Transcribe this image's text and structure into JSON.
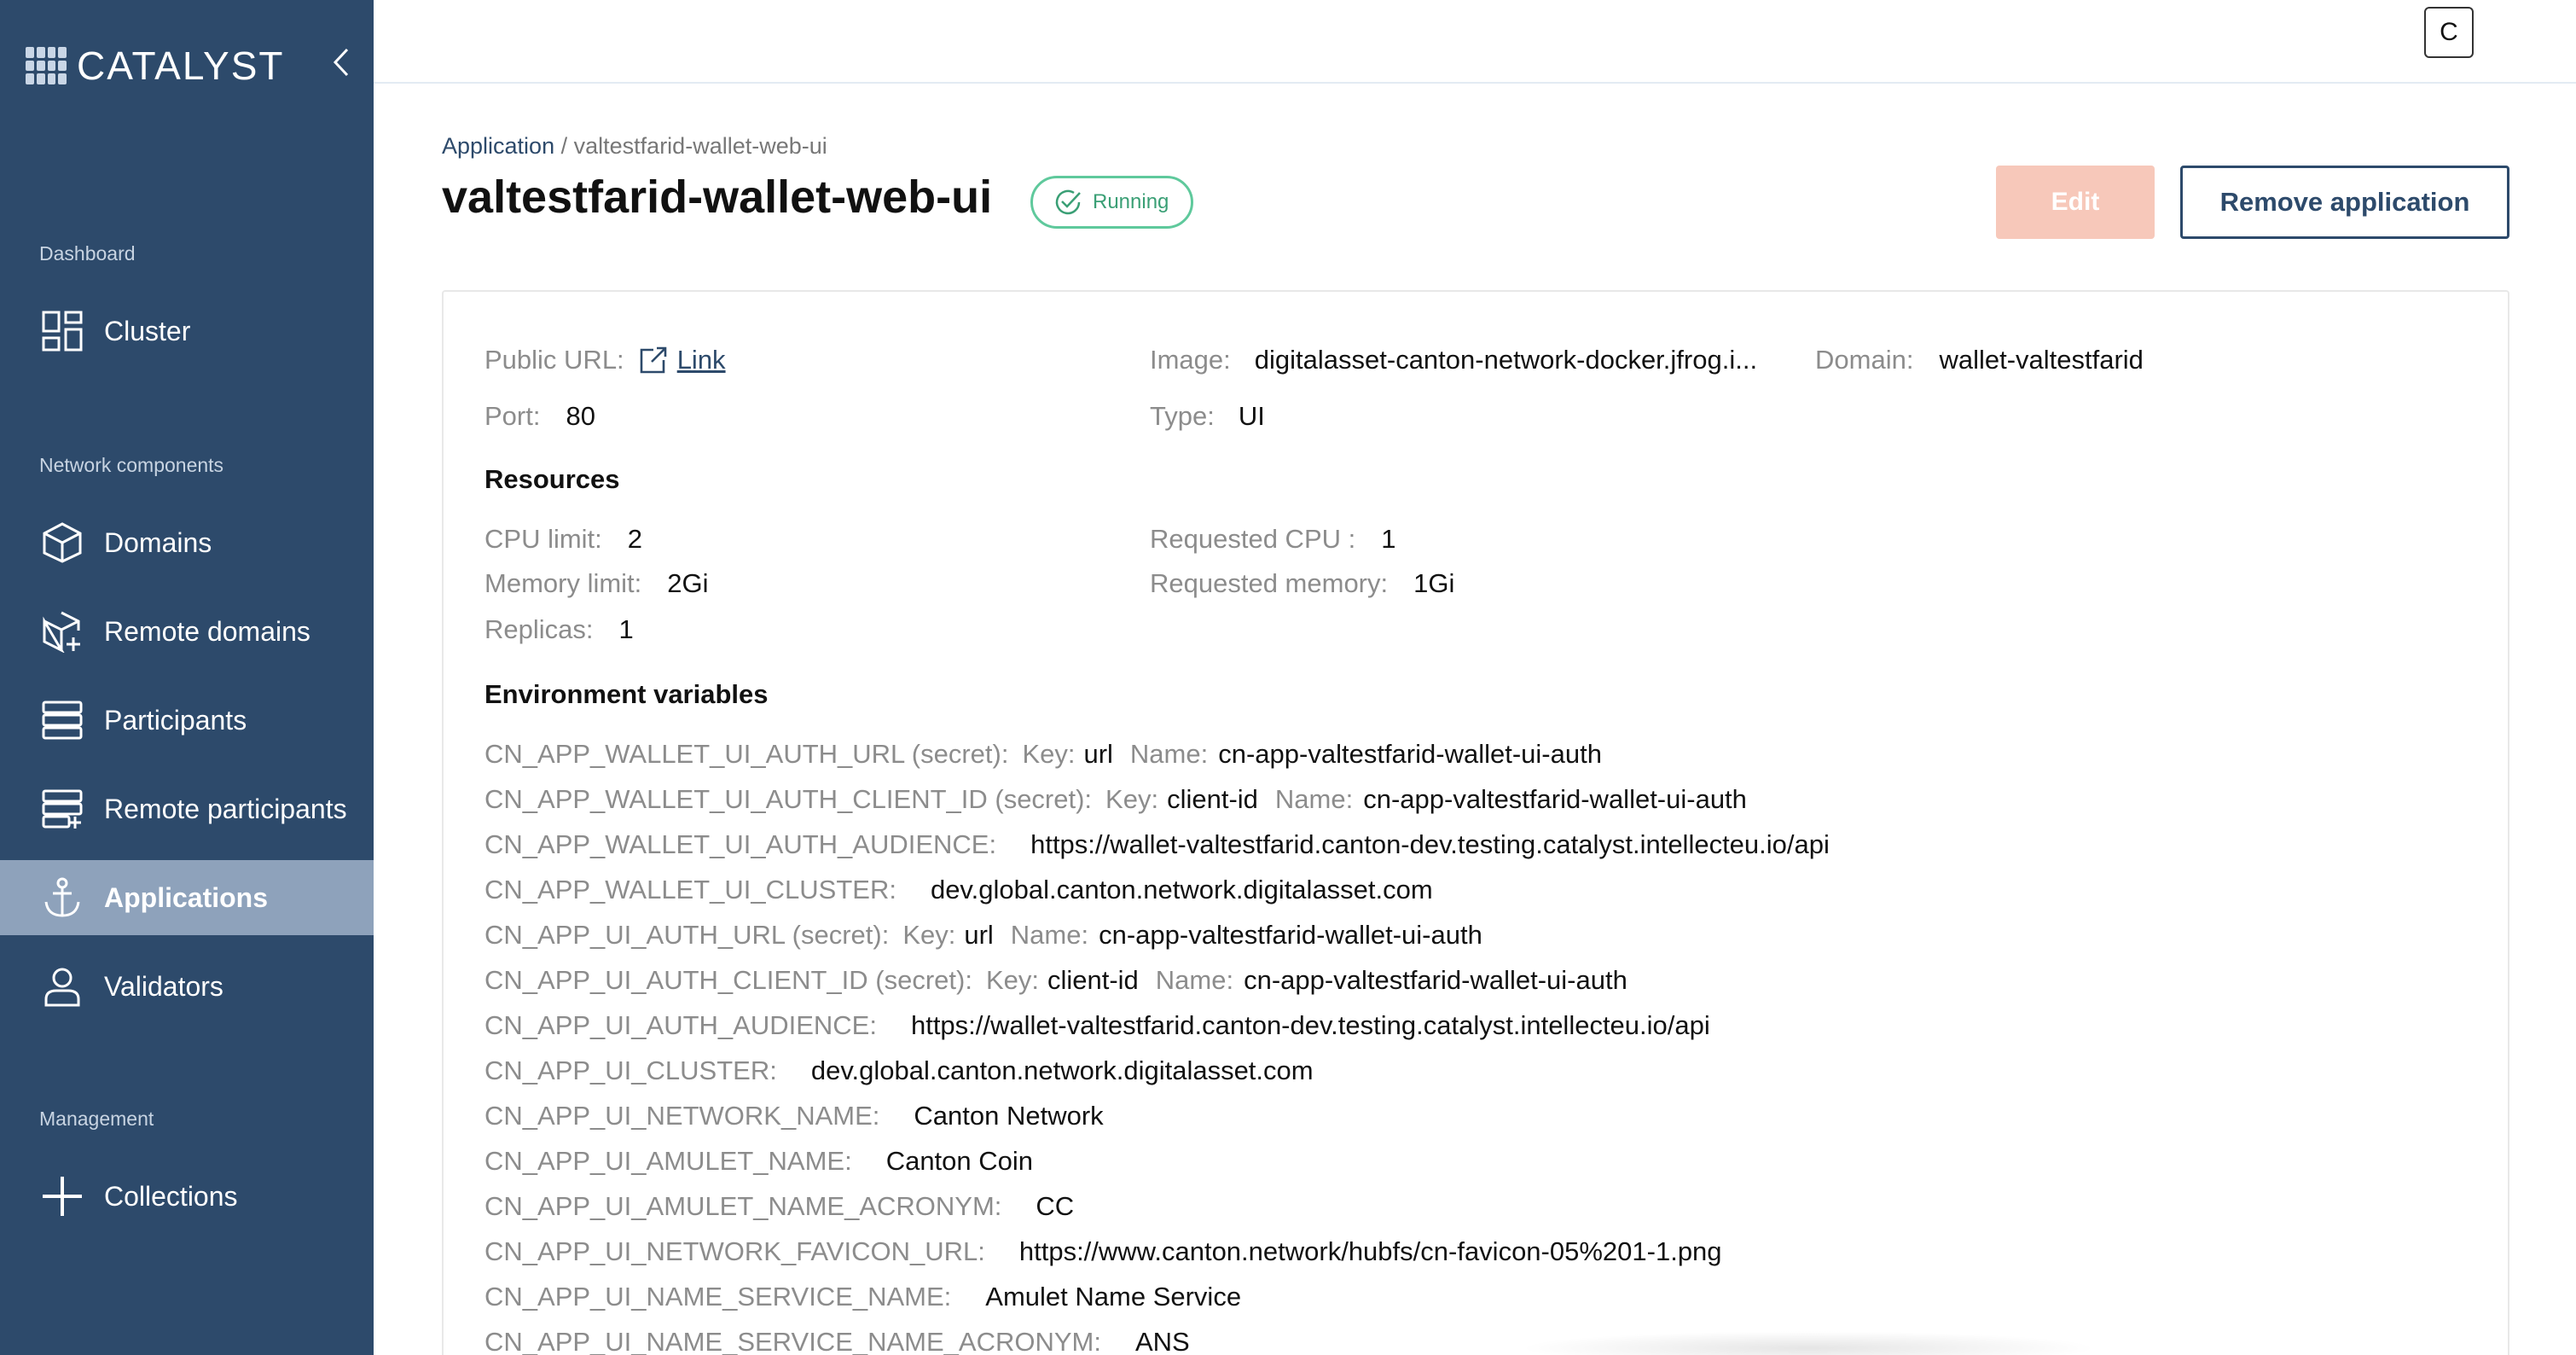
{
  "sidebar": {
    "logo_text": "CATALYST",
    "sections": {
      "dashboard": "Dashboard",
      "network": "Network components",
      "management": "Management"
    },
    "items": {
      "cluster": "Cluster",
      "domains": "Domains",
      "remote_domains": "Remote domains",
      "participants": "Participants",
      "remote_participants": "Remote participants",
      "applications": "Applications",
      "validators": "Validators",
      "collections": "Collections"
    },
    "active_item": "Applications"
  },
  "topbar": {
    "avatar_letter": "C"
  },
  "header": {
    "breadcrumb_root": "Application",
    "breadcrumb_sep": "/",
    "breadcrumb_current": "valtestfarid-wallet-web-ui",
    "title": "valtestfarid-wallet-web-ui",
    "status": "Running",
    "edit_label": "Edit",
    "remove_label": "Remove application"
  },
  "details": {
    "public_url_label": "Public URL:",
    "public_url_link": "Link",
    "image_label": "Image:",
    "image_value": "digitalasset-canton-network-docker.jfrog.i...",
    "domain_label": "Domain:",
    "domain_value": "wallet-valtestfarid",
    "port_label": "Port:",
    "port_value": "80",
    "type_label": "Type:",
    "type_value": "UI"
  },
  "resources": {
    "heading": "Resources",
    "cpu_limit_label": "CPU limit:",
    "cpu_limit_value": "2",
    "requested_cpu_label": "Requested CPU :",
    "requested_cpu_value": "1",
    "memory_limit_label": "Memory limit:",
    "memory_limit_value": "2Gi",
    "requested_memory_label": "Requested memory:",
    "requested_memory_value": "1Gi",
    "replicas_label": "Replicas:",
    "replicas_value": "1"
  },
  "env": {
    "heading": "Environment variables",
    "vars": [
      {
        "name": "CN_APP_WALLET_UI_AUTH_URL (secret):",
        "key_label": "Key:",
        "key": "url",
        "name_label": "Name:",
        "value": "cn-app-valtestfarid-wallet-ui-auth"
      },
      {
        "name": "CN_APP_WALLET_UI_AUTH_CLIENT_ID (secret):",
        "key_label": "Key:",
        "key": "client-id",
        "name_label": "Name:",
        "value": "cn-app-valtestfarid-wallet-ui-auth"
      },
      {
        "name": "CN_APP_WALLET_UI_AUTH_AUDIENCE:",
        "value": "https://wallet-valtestfarid.canton-dev.testing.catalyst.intellecteu.io/api"
      },
      {
        "name": "CN_APP_WALLET_UI_CLUSTER:",
        "value": "dev.global.canton.network.digitalasset.com"
      },
      {
        "name": "CN_APP_UI_AUTH_URL (secret):",
        "key_label": "Key:",
        "key": "url",
        "name_label": "Name:",
        "value": "cn-app-valtestfarid-wallet-ui-auth"
      },
      {
        "name": "CN_APP_UI_AUTH_CLIENT_ID (secret):",
        "key_label": "Key:",
        "key": "client-id",
        "name_label": "Name:",
        "value": "cn-app-valtestfarid-wallet-ui-auth"
      },
      {
        "name": "CN_APP_UI_AUTH_AUDIENCE:",
        "value": "https://wallet-valtestfarid.canton-dev.testing.catalyst.intellecteu.io/api"
      },
      {
        "name": "CN_APP_UI_CLUSTER:",
        "value": "dev.global.canton.network.digitalasset.com"
      },
      {
        "name": "CN_APP_UI_NETWORK_NAME:",
        "value": "Canton Network"
      },
      {
        "name": "CN_APP_UI_AMULET_NAME:",
        "value": "Canton Coin"
      },
      {
        "name": "CN_APP_UI_AMULET_NAME_ACRONYM:",
        "value": "CC"
      },
      {
        "name": "CN_APP_UI_NETWORK_FAVICON_URL:",
        "value": "https://www.canton.network/hubfs/cn-favicon-05%201-1.png"
      },
      {
        "name": "CN_APP_UI_NAME_SERVICE_NAME:",
        "value": "Amulet Name Service"
      },
      {
        "name": "CN_APP_UI_NAME_SERVICE_NAME_ACRONYM:",
        "value": "ANS"
      }
    ]
  }
}
